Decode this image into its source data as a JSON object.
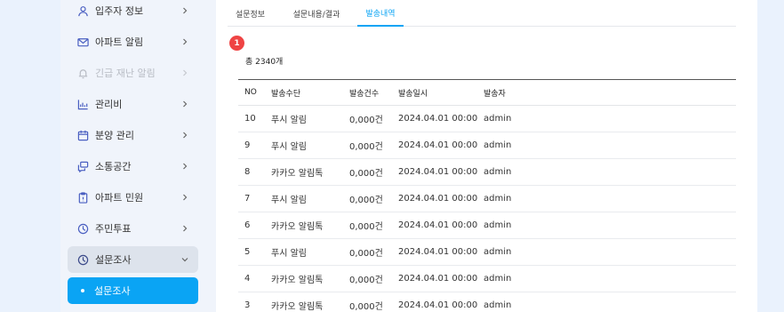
{
  "sidebar": {
    "items": [
      {
        "label": "입주자 정보",
        "icon": "user-icon",
        "state": "normal"
      },
      {
        "label": "아파트 알림",
        "icon": "mail-icon",
        "state": "normal"
      },
      {
        "label": "긴급 재난 알림",
        "icon": "bell-icon",
        "state": "disabled"
      },
      {
        "label": "관리비",
        "icon": "chart-icon",
        "state": "normal"
      },
      {
        "label": "분양 관리",
        "icon": "calendar-icon",
        "state": "normal"
      },
      {
        "label": "소통공간",
        "icon": "chat-icon",
        "state": "normal"
      },
      {
        "label": "아파트 민원",
        "icon": "clipboard-icon",
        "state": "normal"
      },
      {
        "label": "주민투표",
        "icon": "clock-icon",
        "state": "normal"
      },
      {
        "label": "설문조사",
        "icon": "clock-icon",
        "state": "expanded"
      }
    ],
    "active_sub_item": "설문조사"
  },
  "tabs": [
    {
      "label": "설문정보",
      "active": false
    },
    {
      "label": "설문내용/결과",
      "active": false
    },
    {
      "label": "발송내역",
      "active": true
    }
  ],
  "badge": "1",
  "total_text": "총 2340개",
  "table": {
    "headers": [
      "NO",
      "발송수단",
      "발송건수",
      "발송일시",
      "발송자"
    ],
    "rows": [
      [
        "10",
        "푸시 알림",
        "0,000건",
        "2024.04.01 00:00",
        "admin"
      ],
      [
        "9",
        "푸시 알림",
        "0,000건",
        "2024.04.01 00:00",
        "admin"
      ],
      [
        "8",
        "카카오 알림톡",
        "0,000건",
        "2024.04.01 00:00",
        "admin"
      ],
      [
        "7",
        "푸시 알림",
        "0,000건",
        "2024.04.01 00:00",
        "admin"
      ],
      [
        "6",
        "카카오 알림톡",
        "0,000건",
        "2024.04.01 00:00",
        "admin"
      ],
      [
        "5",
        "푸시 알림",
        "0,000건",
        "2024.04.01 00:00",
        "admin"
      ],
      [
        "4",
        "카카오 알림톡",
        "0,000건",
        "2024.04.01 00:00",
        "admin"
      ],
      [
        "3",
        "카카오 알림톡",
        "0,000건",
        "2024.04.01 00:00",
        "admin"
      ]
    ]
  },
  "colors": {
    "accent": "#0aa4f4",
    "badge": "#ef4444",
    "sidebar_bg": "#f0f4fb",
    "expanded_bg": "#dde3ec"
  }
}
